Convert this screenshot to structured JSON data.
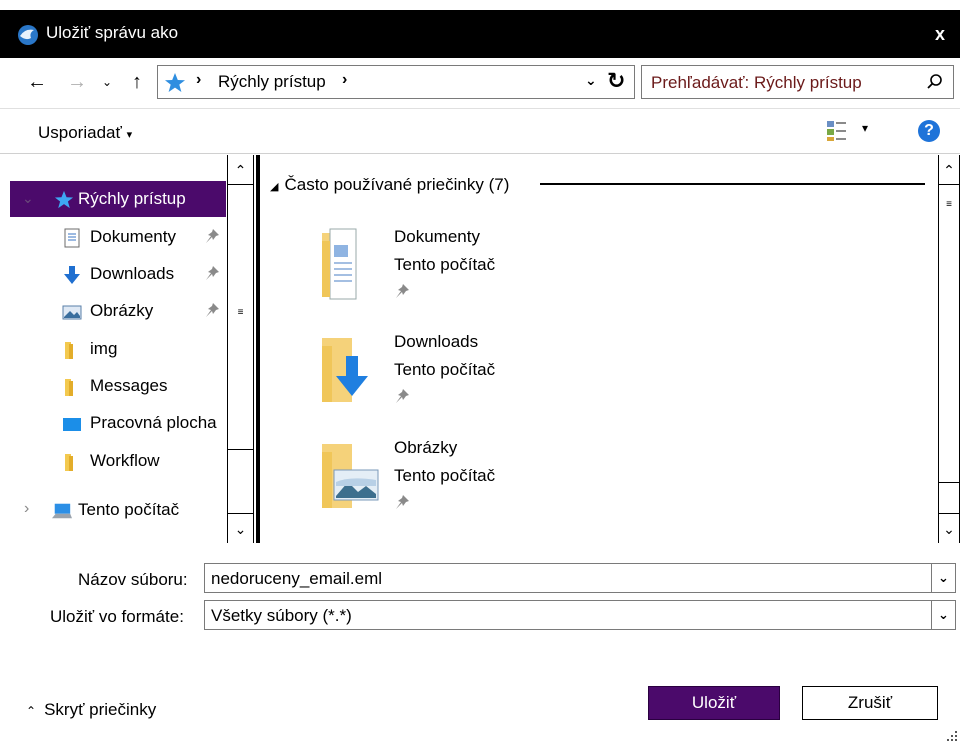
{
  "window": {
    "title": "Uložiť správu ako",
    "close_label": "x"
  },
  "address": {
    "location": "Rýchly prístup",
    "search_placeholder": "Prehľadávať: Rýchly prístup"
  },
  "toolbar": {
    "organize_label": "Usporiadať"
  },
  "nav_pane": {
    "quick_access": "Rýchly prístup",
    "items": [
      {
        "label": "Dokumenty",
        "pinned": true
      },
      {
        "label": "Downloads",
        "pinned": true
      },
      {
        "label": "Obrázky",
        "pinned": true
      },
      {
        "label": "img",
        "pinned": false
      },
      {
        "label": "Messages",
        "pinned": false
      },
      {
        "label": "Pracovná plocha",
        "pinned": false
      },
      {
        "label": "Workflow",
        "pinned": false
      }
    ],
    "this_pc": "Tento počítač"
  },
  "content": {
    "group_title": "Často používané priečinky (7)",
    "tiles": [
      {
        "name": "Dokumenty",
        "location": "Tento počítač"
      },
      {
        "name": "Downloads",
        "location": "Tento počítač"
      },
      {
        "name": "Obrázky",
        "location": "Tento počítač"
      }
    ]
  },
  "form": {
    "filename_label": "Názov súboru:",
    "filename_value": "nedoruceny_email.eml",
    "format_label": "Uložiť vo formáte:",
    "format_value": "Všetky súbory (*.*)"
  },
  "footer": {
    "hide_folders": "Skryť priečinky",
    "save_label": "Uložiť",
    "cancel_label": "Zrušiť"
  },
  "colors": {
    "accent": "#4b0a6b",
    "titlebar": "#000000",
    "help": "#1e73d9"
  }
}
